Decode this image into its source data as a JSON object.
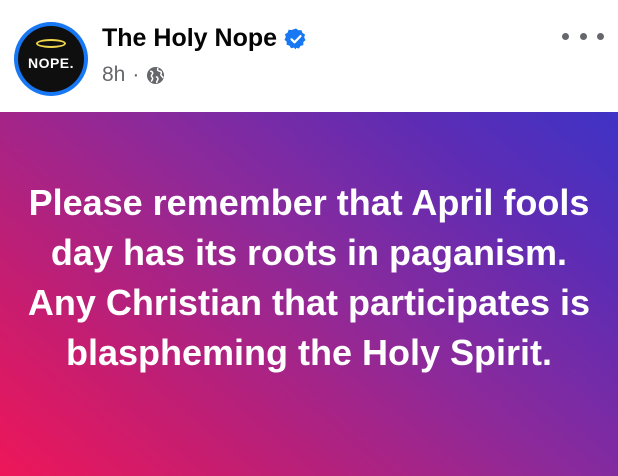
{
  "post": {
    "avatar_text": "NOPE.",
    "page_name": "The Holy Nope",
    "timestamp": "8h",
    "separator": "·",
    "text": "Please remember that April fools day has its roots in paganism. Any Christian that participates is blaspheming the Holy Spirit."
  },
  "icons": {
    "verified": "verified-badge-icon",
    "audience": "globe-icon",
    "more": "more-options-icon"
  },
  "colors": {
    "verified_blue": "#1877f2",
    "meta_gray": "#65676b",
    "gradient_start": "#ee1659",
    "gradient_end": "#3f33c6"
  }
}
